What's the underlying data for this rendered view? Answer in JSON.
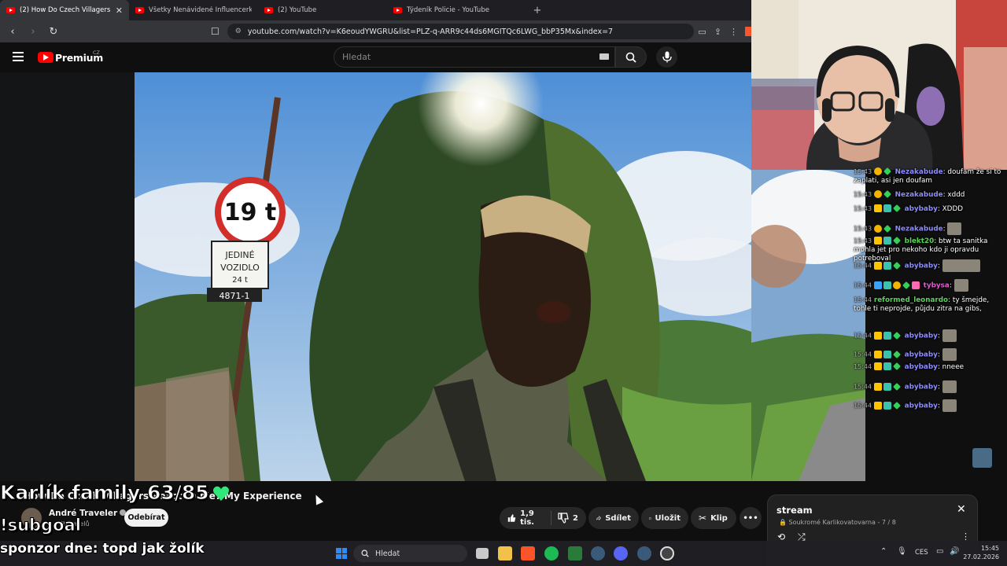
{
  "browser": {
    "tabs": [
      {
        "title": "(2) How Do Czech Villagers Reac",
        "active": true
      },
      {
        "title": "Všetky Nenávidené Influencerky Ktor",
        "active": false
      },
      {
        "title": "(2) YouTube",
        "active": false
      },
      {
        "title": "Týdeník Policie - YouTube",
        "active": false
      }
    ],
    "url": "youtube.com/watch?v=K6eoudYWGRU&list=PLZ-q-ARR9c44ds6MGITQc6LWG_bbP35Mx&index=7"
  },
  "youtube": {
    "brand": "Premium",
    "country_code": "CZ",
    "search_placeholder": "Hledat"
  },
  "video": {
    "title": "How Do Czech Villagers React to Me? My Experience",
    "sign_speed": "19 t",
    "sign_text_1": "JEDINÉ",
    "sign_text_2": "VOZIDLO",
    "sign_text_3": "24 t",
    "sign_code": "4871-1"
  },
  "channel": {
    "name": "André Traveler",
    "subscribers": "…odběratelů",
    "subscribe_label": "Odebírat"
  },
  "actions": {
    "likes": "1,9 tis.",
    "dislikes": "2",
    "share": "Sdílet",
    "save": "Uložit",
    "clip": "Klip"
  },
  "overlays": {
    "goal": "Karlík family 63/85",
    "subgoal": "!subgoal",
    "sponsor": "sponzor dne: topd jak žolík"
  },
  "chat": {
    "messages": [
      {
        "time": "15:43",
        "user": "Nezakabude",
        "color": "purple",
        "text": "doufam že si to zaplati, asi jen doufam"
      },
      {
        "time": "15:43",
        "user": "Nezakabude",
        "color": "purple",
        "text": "xddd"
      },
      {
        "time": "15:43",
        "user": "abybaby",
        "color": "purple",
        "text": "XDDD"
      },
      {
        "time": "15:43",
        "user": "Nezakabude",
        "color": "purple",
        "text": ""
      },
      {
        "time": "15:43",
        "user": "blekt20",
        "color": "green",
        "text": "btw ta sanitka mohla jet pro nekoho kdo ji opravdu potreboval"
      },
      {
        "time": "15:44",
        "user": "abybaby",
        "color": "purple",
        "text": ""
      },
      {
        "time": "15:44",
        "user": "tybysa",
        "color": "pink",
        "text": ""
      },
      {
        "time": "15:44",
        "user": "reformed_leonardo",
        "color": "green",
        "text": "ty šmejde, tohle ti neprojde, půjdu zitra na gibs,"
      },
      {
        "time": "15:44",
        "user": "abybaby",
        "color": "purple",
        "text": ""
      },
      {
        "time": "15:44",
        "user": "abybaby",
        "color": "purple",
        "text": ""
      },
      {
        "time": "15:44",
        "user": "abybaby",
        "color": "purple",
        "text": "nneee"
      },
      {
        "time": "15:44",
        "user": "abybaby",
        "color": "purple",
        "text": ""
      },
      {
        "time": "15:44",
        "user": "abybaby",
        "color": "purple",
        "text": ""
      }
    ],
    "colors": {
      "purple": "#8e8cff",
      "green": "#5bd35b",
      "pink": "#e65bd3"
    }
  },
  "playlist": {
    "title": "stream",
    "privacy": "Soukromé",
    "owner": "Karlikovatovarna",
    "position": "7 / 8"
  },
  "taskbar": {
    "search_placeholder": "Hledat",
    "language": "CES",
    "time": "15:45",
    "date": "27.02.2026"
  }
}
